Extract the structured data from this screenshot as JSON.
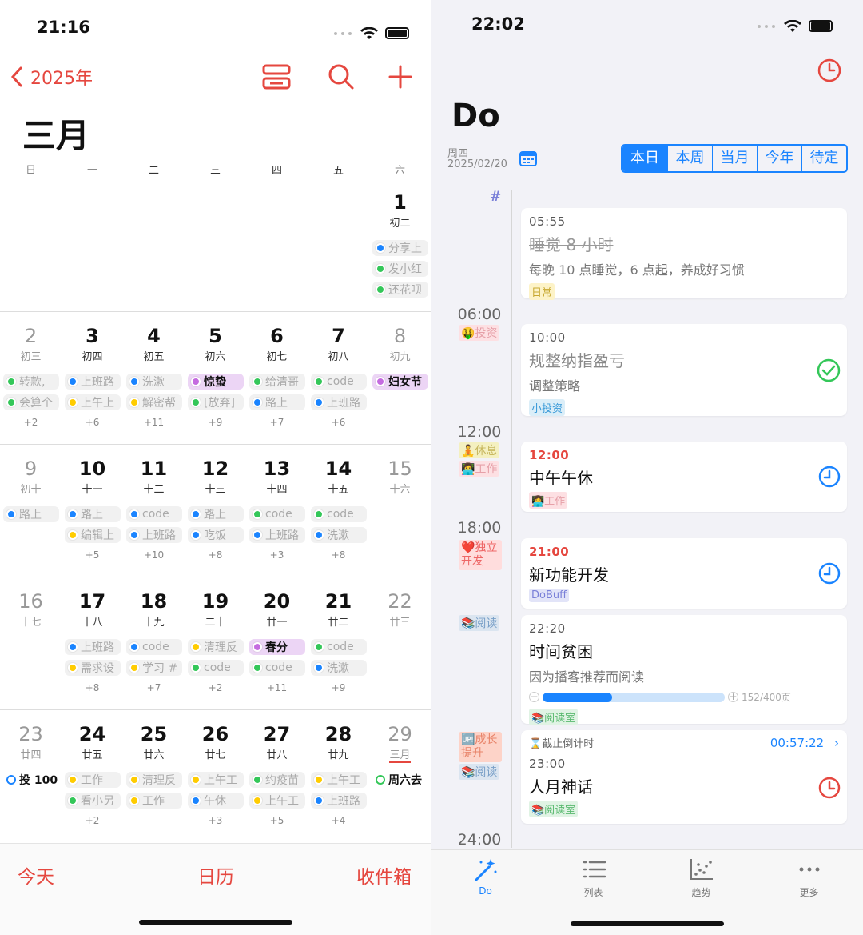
{
  "left": {
    "status_time": "21:16",
    "nav": {
      "back_label": "2025年"
    },
    "month_title": "三月",
    "weekdays": [
      "日",
      "一",
      "二",
      "三",
      "四",
      "五",
      "六"
    ],
    "weeks": [
      {
        "days": [
          {},
          {},
          {},
          {},
          {},
          {},
          {
            "num": "1",
            "lunar": "初二",
            "gray": false
          }
        ],
        "events": [
          {
            "col": 6,
            "row": 0,
            "text": "分享上",
            "color": "#1a84ff"
          },
          {
            "col": 6,
            "row": 1,
            "text": "发小红",
            "color": "#34c759"
          },
          {
            "col": 6,
            "row": 2,
            "text": "还花呗",
            "color": "#34c759"
          }
        ],
        "more": []
      },
      {
        "days": [
          {
            "num": "2",
            "lunar": "初三",
            "gray": true
          },
          {
            "num": "3",
            "lunar": "初四"
          },
          {
            "num": "4",
            "lunar": "初五"
          },
          {
            "num": "5",
            "lunar": "初六"
          },
          {
            "num": "6",
            "lunar": "初七"
          },
          {
            "num": "7",
            "lunar": "初八"
          },
          {
            "num": "8",
            "lunar": "初九",
            "gray": true
          }
        ],
        "events": [
          {
            "col": 0,
            "row": 0,
            "text": "转款,",
            "color": "#34c759"
          },
          {
            "col": 0,
            "row": 1,
            "text": "会算个",
            "color": "#34c759"
          },
          {
            "col": 1,
            "row": 0,
            "text": "上班路",
            "color": "#1a84ff"
          },
          {
            "col": 1,
            "row": 1,
            "text": "上午上",
            "color": "#ffcc00"
          },
          {
            "col": 2,
            "row": 0,
            "text": "洗漱",
            "color": "#1a84ff"
          },
          {
            "col": 2,
            "row": 1,
            "text": "解密帮",
            "color": "#ffcc00"
          },
          {
            "col": 3,
            "row": 0,
            "text": "惊蛰",
            "color": "#c56be0",
            "hl": true,
            "bg": "#ecd5f5"
          },
          {
            "col": 3,
            "row": 1,
            "text": "[放弃]",
            "color": "#34c759"
          },
          {
            "col": 4,
            "row": 0,
            "text": "给清哥",
            "color": "#34c759"
          },
          {
            "col": 4,
            "row": 1,
            "text": "路上",
            "color": "#1a84ff"
          },
          {
            "col": 5,
            "row": 0,
            "text": "code",
            "color": "#34c759"
          },
          {
            "col": 5,
            "row": 1,
            "text": "上班路",
            "color": "#1a84ff"
          },
          {
            "col": 6,
            "row": 0,
            "text": "妇女节",
            "color": "#c56be0",
            "hl": true,
            "bg": "#ecd5f5"
          }
        ],
        "more": [
          {
            "col": 0,
            "text": "+2"
          },
          {
            "col": 1,
            "text": "+6"
          },
          {
            "col": 2,
            "text": "+11"
          },
          {
            "col": 3,
            "text": "+9"
          },
          {
            "col": 4,
            "text": "+7"
          },
          {
            "col": 5,
            "text": "+6"
          }
        ]
      },
      {
        "days": [
          {
            "num": "9",
            "lunar": "初十",
            "gray": true
          },
          {
            "num": "10",
            "lunar": "十一"
          },
          {
            "num": "11",
            "lunar": "十二"
          },
          {
            "num": "12",
            "lunar": "十三"
          },
          {
            "num": "13",
            "lunar": "十四"
          },
          {
            "num": "14",
            "lunar": "十五"
          },
          {
            "num": "15",
            "lunar": "十六",
            "gray": true
          }
        ],
        "events": [
          {
            "col": 0,
            "row": 0,
            "text": "路上",
            "color": "#1a84ff"
          },
          {
            "col": 1,
            "row": 0,
            "text": "路上",
            "color": "#1a84ff"
          },
          {
            "col": 1,
            "row": 1,
            "text": "编辑上",
            "color": "#ffcc00"
          },
          {
            "col": 2,
            "row": 0,
            "text": "code",
            "color": "#1a84ff"
          },
          {
            "col": 2,
            "row": 1,
            "text": "上班路",
            "color": "#1a84ff"
          },
          {
            "col": 3,
            "row": 0,
            "text": "路上",
            "color": "#1a84ff"
          },
          {
            "col": 3,
            "row": 1,
            "text": "吃饭",
            "color": "#1a84ff"
          },
          {
            "col": 4,
            "row": 0,
            "text": "code",
            "color": "#34c759"
          },
          {
            "col": 4,
            "row": 1,
            "text": "上班路",
            "color": "#1a84ff"
          },
          {
            "col": 5,
            "row": 0,
            "text": "code",
            "color": "#34c759"
          },
          {
            "col": 5,
            "row": 1,
            "text": "洗漱",
            "color": "#1a84ff"
          }
        ],
        "more": [
          {
            "col": 1,
            "text": "+5"
          },
          {
            "col": 2,
            "text": "+10"
          },
          {
            "col": 3,
            "text": "+8"
          },
          {
            "col": 4,
            "text": "+3"
          },
          {
            "col": 5,
            "text": "+8"
          }
        ]
      },
      {
        "days": [
          {
            "num": "16",
            "lunar": "十七",
            "gray": true
          },
          {
            "num": "17",
            "lunar": "十八"
          },
          {
            "num": "18",
            "lunar": "十九"
          },
          {
            "num": "19",
            "lunar": "二十"
          },
          {
            "num": "20",
            "lunar": "廿一"
          },
          {
            "num": "21",
            "lunar": "廿二"
          },
          {
            "num": "22",
            "lunar": "廿三",
            "gray": true
          }
        ],
        "events": [
          {
            "col": 1,
            "row": 0,
            "text": "上班路",
            "color": "#1a84ff"
          },
          {
            "col": 1,
            "row": 1,
            "text": "需求设",
            "color": "#ffcc00"
          },
          {
            "col": 2,
            "row": 0,
            "text": "code",
            "color": "#1a84ff"
          },
          {
            "col": 2,
            "row": 1,
            "text": "学习 #",
            "color": "#ffcc00"
          },
          {
            "col": 3,
            "row": 0,
            "text": "清理反",
            "color": "#ffcc00"
          },
          {
            "col": 3,
            "row": 1,
            "text": "code",
            "color": "#34c759"
          },
          {
            "col": 4,
            "row": 0,
            "text": "春分",
            "color": "#c56be0",
            "hl": true,
            "bg": "#ecd5f5"
          },
          {
            "col": 4,
            "row": 1,
            "text": "code",
            "color": "#34c759"
          },
          {
            "col": 5,
            "row": 0,
            "text": "code",
            "color": "#34c759"
          },
          {
            "col": 5,
            "row": 1,
            "text": "洗漱",
            "color": "#1a84ff"
          }
        ],
        "more": [
          {
            "col": 1,
            "text": "+8"
          },
          {
            "col": 2,
            "text": "+7"
          },
          {
            "col": 3,
            "text": "+2"
          },
          {
            "col": 4,
            "text": "+11"
          },
          {
            "col": 5,
            "text": "+9"
          }
        ]
      },
      {
        "days": [
          {
            "num": "23",
            "lunar": "廿四",
            "gray": true
          },
          {
            "num": "24",
            "lunar": "廿五"
          },
          {
            "num": "25",
            "lunar": "廿六"
          },
          {
            "num": "26",
            "lunar": "廿七"
          },
          {
            "num": "27",
            "lunar": "廿八"
          },
          {
            "num": "28",
            "lunar": "廿九"
          },
          {
            "num": "29",
            "lunar": "三月",
            "gray": true,
            "underline": true
          }
        ],
        "events": [
          {
            "col": 0,
            "row": 0,
            "text": "投 100",
            "color": "#1a84ff",
            "hl": true,
            "bg": "#fff",
            "ring": true
          },
          {
            "col": 1,
            "row": 0,
            "text": "工作",
            "color": "#ffcc00"
          },
          {
            "col": 1,
            "row": 1,
            "text": "看小另",
            "color": "#34c759"
          },
          {
            "col": 2,
            "row": 0,
            "text": "清理反",
            "color": "#ffcc00"
          },
          {
            "col": 2,
            "row": 1,
            "text": "工作",
            "color": "#ffcc00"
          },
          {
            "col": 3,
            "row": 0,
            "text": "上午工",
            "color": "#ffcc00"
          },
          {
            "col": 3,
            "row": 1,
            "text": "午休",
            "color": "#1a84ff"
          },
          {
            "col": 4,
            "row": 0,
            "text": "约疫苗",
            "color": "#34c759"
          },
          {
            "col": 4,
            "row": 1,
            "text": "上午工",
            "color": "#ffcc00"
          },
          {
            "col": 5,
            "row": 0,
            "text": "上午工",
            "color": "#ffcc00"
          },
          {
            "col": 5,
            "row": 1,
            "text": "上班路",
            "color": "#1a84ff"
          },
          {
            "col": 6,
            "row": 0,
            "text": "周六去",
            "color": "#34c759",
            "hl": true,
            "bg": "#fff",
            "ring": true
          }
        ],
        "more": [
          {
            "col": 1,
            "text": "+2"
          },
          {
            "col": 3,
            "text": "+3"
          },
          {
            "col": 4,
            "text": "+5"
          },
          {
            "col": 5,
            "text": "+4"
          }
        ]
      }
    ],
    "bottom": {
      "today": "今天",
      "calendar": "日历",
      "inbox": "收件箱"
    }
  },
  "right": {
    "status_time": "22:02",
    "title": "Do",
    "weekday": "周四",
    "date": "2025/02/20",
    "segments": [
      "本日",
      "本周",
      "当月",
      "今年",
      "待定"
    ],
    "hash": "#",
    "hours": [
      "06:00",
      "12:00",
      "18:00",
      "24:00"
    ],
    "side_tags": [
      {
        "text": "🤑投资",
        "bg": "#fde0e3",
        "color": "#e6a0a8"
      },
      {
        "text": "🧘休息",
        "bg": "#f4f0c0",
        "color": "#c8b860"
      },
      {
        "text": "👩‍💻工作",
        "bg": "#fde0e3",
        "color": "#e6a0a8"
      },
      {
        "text": "❤️独立开发",
        "bg": "#fdd",
        "color": "#e66"
      },
      {
        "text": "📚阅读",
        "bg": "#dbe5f0",
        "color": "#7aa0c8"
      },
      {
        "text": "🆙成长提升",
        "bg": "#fdd3c8",
        "color": "#e8846a"
      },
      {
        "text": "📚阅读",
        "bg": "#dbe5f0",
        "color": "#7aa0c8"
      }
    ],
    "cards": [
      {
        "time": "05:55",
        "title": "睡觉 8 小时",
        "sub": "每晚 10 点睡觉，6 点起，养成好习惯",
        "tag": "日常",
        "tag_bg": "#fdf3c8",
        "tag_color": "#c8a830",
        "struck": true
      },
      {
        "time": "10:00",
        "title": "规整纳指盈亏",
        "sub": "调整策略",
        "tag": "小投资",
        "tag_bg": "#dbeef8",
        "tag_color": "#3a9ad8",
        "done": true
      },
      {
        "time": "12:00",
        "title": "中午午休",
        "tag": "👩‍💻工作",
        "tag_bg": "#fde0e3",
        "tag_color": "#e6a0a8",
        "red_time": true
      },
      {
        "time": "21:00",
        "title": "新功能开发",
        "tag": "DoBuff",
        "tag_bg": "#e2e4f8",
        "tag_color": "#7a80d8",
        "red_time": true
      },
      {
        "time": "22:20",
        "title": "时间贫困",
        "sub": "因为播客推荐而阅读",
        "tag": "📚阅读室",
        "tag_bg": "#e0f3e4",
        "tag_color": "#5aba70",
        "progress": 0.38,
        "progress_text": "152/400页"
      },
      {
        "countdown_label": "截止倒计时",
        "countdown": "00:57:22",
        "time": "23:00",
        "title": "人月神话",
        "tag": "📚阅读室",
        "tag_bg": "#e0f3e4",
        "tag_color": "#5aba70"
      }
    ],
    "tabs": [
      "Do",
      "列表",
      "趋势",
      "更多"
    ],
    "colors": {
      "accent": "#1a84ff",
      "red": "#e5473f"
    }
  }
}
